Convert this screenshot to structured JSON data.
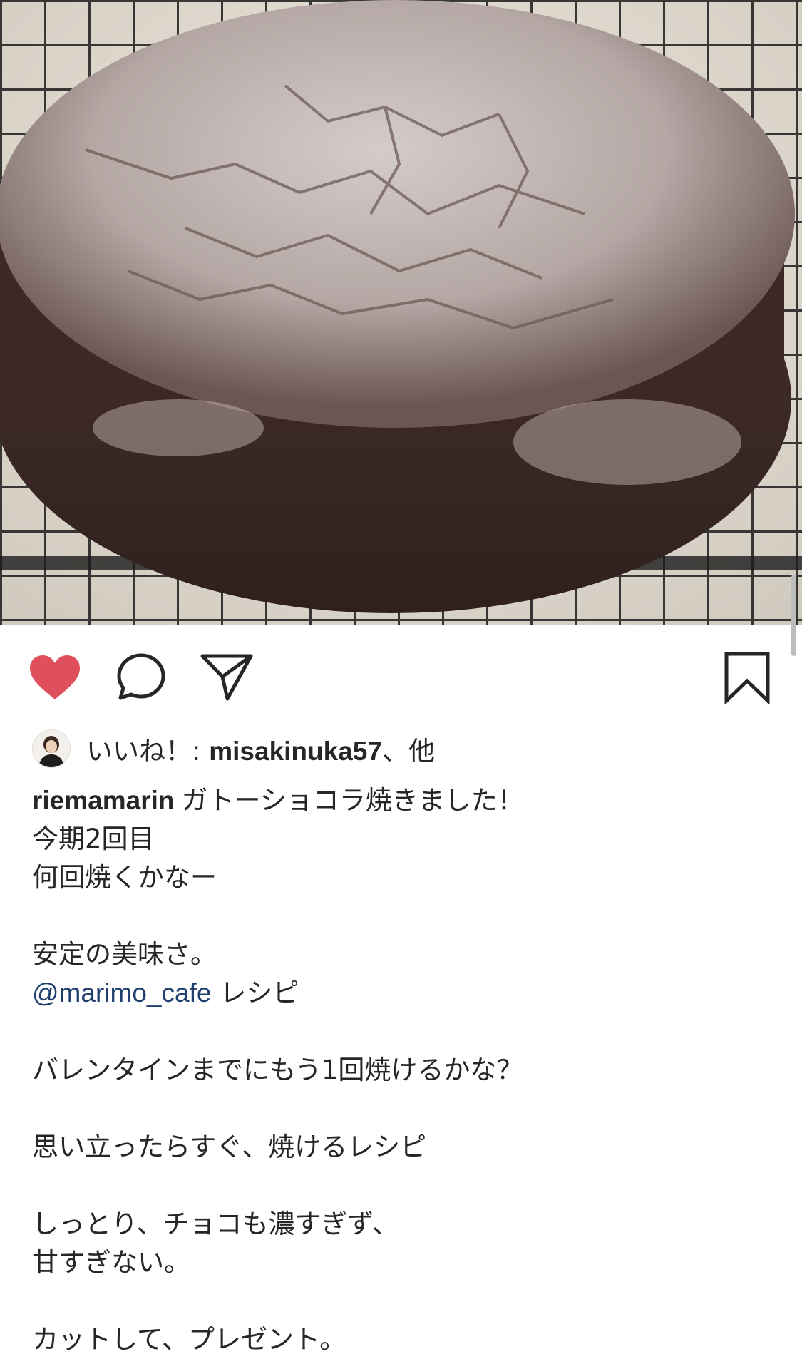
{
  "post": {
    "image_alt": "ガトーショコラ",
    "colors": {
      "like_red": "#ed4956",
      "mention_blue": "#1f3f6e",
      "text": "#262626"
    }
  },
  "actions": {
    "like_icon": "heart-filled-icon",
    "comment_icon": "comment-bubble-icon",
    "share_icon": "paper-plane-icon",
    "save_icon": "bookmark-icon"
  },
  "likes": {
    "prefix": "いいね！: ",
    "user": "misakinuka57",
    "suffix": "、他"
  },
  "caption": {
    "username": "riemamarin",
    "first_line": "ガトーショコラ焼きました！",
    "line2": "今期2回目",
    "line3": "何回焼くかなー",
    "line4": "安定の美味さ。",
    "mention": "@marimo_cafe",
    "mention_suffix": "レシピ",
    "line6": "バレンタインまでにもう1回焼けるかな？",
    "line7": "思い立ったらすぐ、焼けるレシピ",
    "line8": "しっとり、チョコも濃すぎず、",
    "line9": "甘すぎない。",
    "line10": "カットして、プレゼント。"
  }
}
